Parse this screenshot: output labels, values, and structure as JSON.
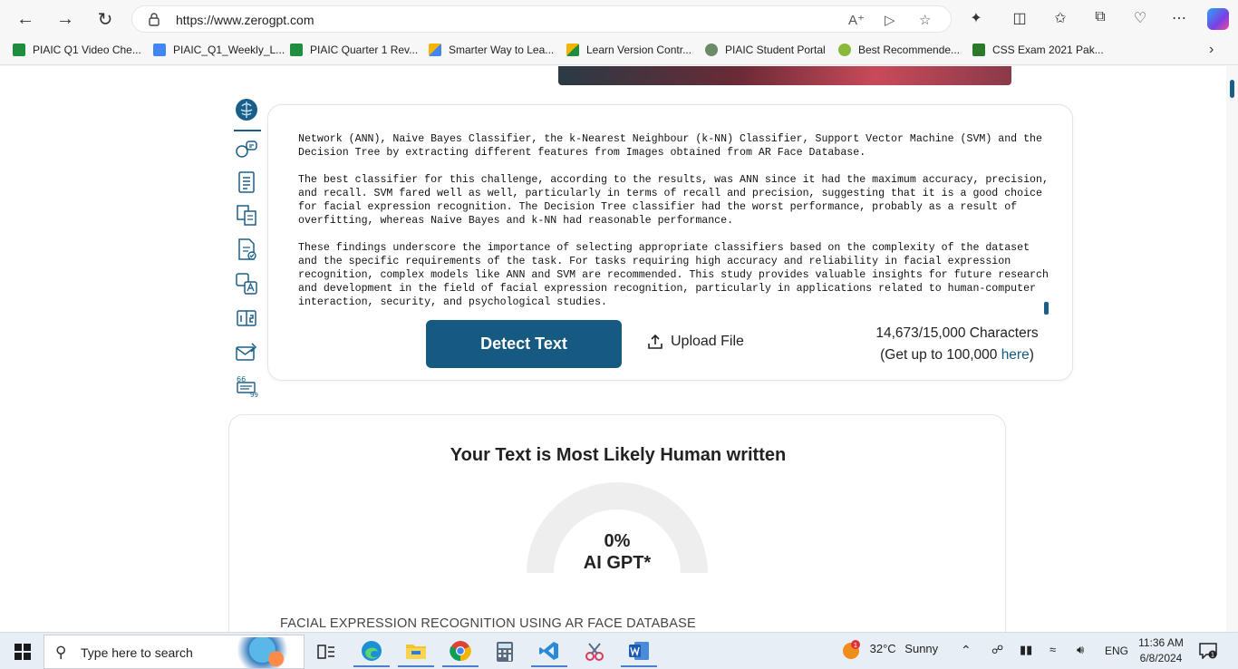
{
  "browser": {
    "url": "https://www.zerogpt.com",
    "bookmarks": [
      {
        "label": "PIAIC Q1 Video Che...",
        "color": "#1e8e3e"
      },
      {
        "label": "PIAIC_Q1_Weekly_L...",
        "color": "#4285f4"
      },
      {
        "label": "PIAIC Quarter 1 Rev...",
        "color": "#1e8e3e"
      },
      {
        "label": "Smarter Way to Lea...",
        "color": "#f4b400"
      },
      {
        "label": "Learn Version Contr...",
        "color": "#f4b400"
      },
      {
        "label": "PIAIC Student Portal",
        "color": "#6a8a6a"
      },
      {
        "label": "Best Recommende...",
        "color": "#8ab83a"
      },
      {
        "label": "CSS Exam 2021 Pak...",
        "color": "#2a7a2a"
      }
    ]
  },
  "editor": {
    "paragraphs": [
      "Network (ANN), Naive Bayes Classifier, the k-Nearest Neighbour (k-NN) Classifier, Support Vector Machine (SVM) and the Decision Tree by extracting different features from Images obtained from AR Face Database.",
      "The best classifier for this challenge, according to the results, was ANN since it had the maximum accuracy, precision, and recall. SVM fared well as well, particularly in terms of recall and precision, suggesting that it is a good choice for facial expression recognition. The Decision Tree classifier had the worst performance, probably as a result of overfitting, whereas Naive Bayes and k-NN had reasonable performance.",
      "These findings underscore the importance of selecting appropriate classifiers based on the complexity of the dataset and the specific requirements of the task. For tasks requiring high accuracy and reliability in facial expression recognition, complex models like ANN and SVM are recommended. This study provides valuable insights for future research and development in the field of facial expression recognition, particularly in applications related to human-computer interaction, security, and psychological studies."
    ],
    "detect_label": "Detect Text",
    "upload_label": "Upload File",
    "char_count": "14,673/15,000 Characters",
    "upgrade_prefix": "(Get up to 100,000 ",
    "upgrade_link": "here",
    "upgrade_suffix": ")"
  },
  "result": {
    "title": "Your Text is Most Likely Human written",
    "percent": "0%",
    "percent_value": 0,
    "gauge_label": "AI GPT*",
    "doc_title": "FACIAL EXPRESSION RECOGNITION USING AR FACE DATABASE"
  },
  "taskbar": {
    "search_placeholder": "Type here to search",
    "weather_badge": "1",
    "weather_temp": "32°C",
    "weather_text": "Sunny",
    "language": "ENG",
    "time": "11:36 AM",
    "date": "6/8/2024",
    "notification_count": "1"
  }
}
